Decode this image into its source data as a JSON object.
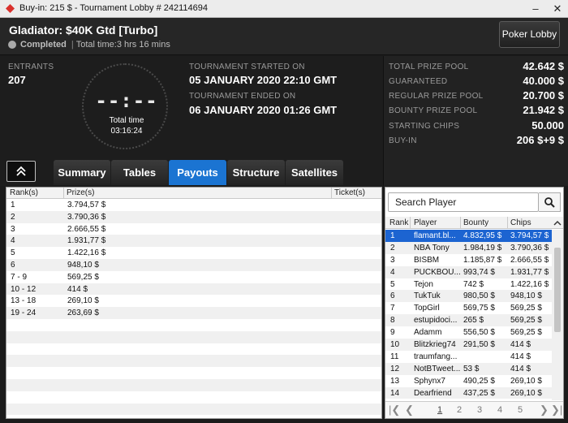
{
  "window": {
    "title": "Buy-in: 215 $ - Tournament Lobby # 242114694",
    "minimize": "–",
    "close": "✕"
  },
  "header": {
    "tournament_name": "Gladiator: $40K Gtd [Turbo]",
    "status": "Completed",
    "separator": "|",
    "total_time_text": "Total time:3 hrs  16 mins",
    "lobby_button": "Poker Lobby"
  },
  "info": {
    "entrants_label": "ENTRANTS",
    "entrants_value": "207",
    "clock_digits": "--:--",
    "clock_label": "Total time",
    "clock_value": "03:16:24",
    "started_label": "TOURNAMENT STARTED ON",
    "started_value": "05 JANUARY 2020  22:10 GMT",
    "ended_label": "TOURNAMENT ENDED ON",
    "ended_value": "06 JANUARY 2020  01:26 GMT"
  },
  "prizes": [
    {
      "label": "TOTAL PRIZE POOL",
      "value": "42.642 $"
    },
    {
      "label": "GUARANTEED",
      "value": "40.000 $"
    },
    {
      "label": "REGULAR PRIZE POOL",
      "value": "20.700 $"
    },
    {
      "label": "BOUNTY PRIZE POOL",
      "value": "21.942 $"
    },
    {
      "label": "STARTING CHIPS",
      "value": "50.000"
    },
    {
      "label": "BUY-IN",
      "value": "206 $+9 $"
    }
  ],
  "tabs": [
    {
      "label": "Summary",
      "active": false
    },
    {
      "label": "Tables",
      "active": false
    },
    {
      "label": "Payouts",
      "active": true
    },
    {
      "label": "Structure",
      "active": false
    },
    {
      "label": "Satellites",
      "active": false
    }
  ],
  "payouts": {
    "columns": [
      "Rank(s)",
      "Prize(s)",
      "Ticket(s)"
    ],
    "rows": [
      {
        "rank": "1",
        "prize": "3.794,57 $"
      },
      {
        "rank": "2",
        "prize": "3.790,36 $"
      },
      {
        "rank": "3",
        "prize": "2.666,55 $"
      },
      {
        "rank": "4",
        "prize": "1.931,77 $"
      },
      {
        "rank": "5",
        "prize": "1.422,16 $"
      },
      {
        "rank": "6",
        "prize": "948,10 $"
      },
      {
        "rank": "7 - 9",
        "prize": "569,25 $"
      },
      {
        "rank": "10 - 12",
        "prize": "414 $"
      },
      {
        "rank": "13 - 18",
        "prize": "269,10 $"
      },
      {
        "rank": "19 - 24",
        "prize": "263,69 $"
      }
    ],
    "empty_rows": 8
  },
  "players": {
    "search_placeholder": "Search Player",
    "columns": [
      "Rank",
      "Player",
      "Bounty",
      "Chips"
    ],
    "rows": [
      {
        "rank": "1",
        "player": "flamant.bl...",
        "bounty": "4.832,95 $",
        "chips": "3.794,57 $",
        "selected": true
      },
      {
        "rank": "2",
        "player": "NBA Tony",
        "bounty": "1.984,19 $",
        "chips": "3.790,36 $"
      },
      {
        "rank": "3",
        "player": "BISBM",
        "bounty": "1.185,87 $",
        "chips": "2.666,55 $"
      },
      {
        "rank": "4",
        "player": "PUCKBOU...",
        "bounty": "993,74 $",
        "chips": "1.931,77 $"
      },
      {
        "rank": "5",
        "player": "Tejon",
        "bounty": "742 $",
        "chips": "1.422,16 $"
      },
      {
        "rank": "6",
        "player": "TukTuk",
        "bounty": "980,50 $",
        "chips": "948,10 $"
      },
      {
        "rank": "7",
        "player": "TopGirl",
        "bounty": "569,75 $",
        "chips": "569,25 $"
      },
      {
        "rank": "8",
        "player": "estupidoci...",
        "bounty": "265 $",
        "chips": "569,25 $"
      },
      {
        "rank": "9",
        "player": "Adamm",
        "bounty": "556,50 $",
        "chips": "569,25 $"
      },
      {
        "rank": "10",
        "player": "Blitzkrieg74",
        "bounty": "291,50 $",
        "chips": "414 $"
      },
      {
        "rank": "11",
        "player": "traumfang...",
        "bounty": "",
        "chips": "414 $"
      },
      {
        "rank": "12",
        "player": "NotBTweet...",
        "bounty": "53 $",
        "chips": "414 $"
      },
      {
        "rank": "13",
        "player": "Sphynx7",
        "bounty": "490,25 $",
        "chips": "269,10 $"
      },
      {
        "rank": "14",
        "player": "Dearfriend",
        "bounty": "437,25 $",
        "chips": "269,10 $"
      }
    ],
    "pages": [
      "1",
      "2",
      "3",
      "4",
      "5"
    ],
    "active_page": "1"
  }
}
